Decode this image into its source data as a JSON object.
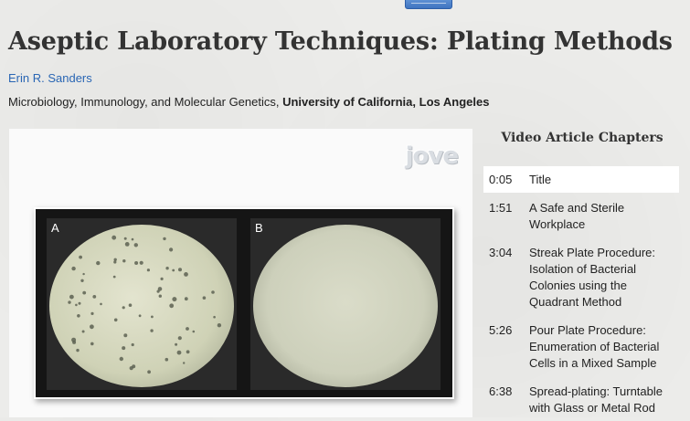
{
  "article": {
    "title": "Aseptic Laboratory Techniques: Plating Methods",
    "author": "Erin R. Sanders",
    "department": "Microbiology, Immunology, and Molecular Genetics, ",
    "institution": "University of California, Los Angeles"
  },
  "video": {
    "logo": "jove",
    "panel_a_label": "A",
    "panel_b_label": "B"
  },
  "chapters": {
    "heading": "Video Article Chapters",
    "items": [
      {
        "time": "0:05",
        "label": "Title"
      },
      {
        "time": "1:51",
        "label": "A Safe and Sterile Workplace"
      },
      {
        "time": "3:04",
        "label": "Streak Plate Procedure: Isolation of Bacterial Colonies using the Quadrant Method"
      },
      {
        "time": "5:26",
        "label": "Pour Plate Procedure: Enumeration of Bacterial Cells in a Mixed Sample"
      },
      {
        "time": "6:38",
        "label": "Spread-plating: Turntable with Glass or Metal Rod"
      }
    ]
  },
  "colors": {
    "link": "#2a66b4",
    "background": "#ececea",
    "tab": "#3f74c0"
  }
}
